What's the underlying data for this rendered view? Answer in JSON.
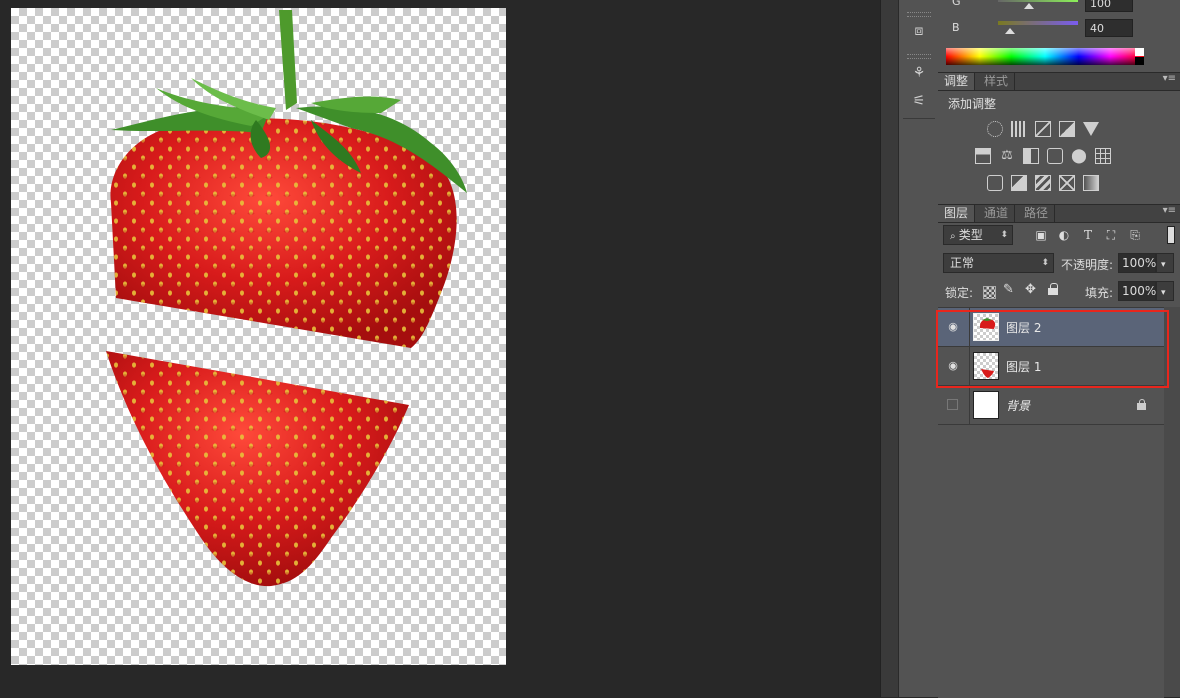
{
  "color_panel": {
    "g_label": "G",
    "g_value": "100",
    "g_ratio": 0.39,
    "b_label": "B",
    "b_value": "40",
    "b_ratio": 0.16
  },
  "adjust_panel": {
    "tabs": [
      {
        "label": "调整"
      },
      {
        "label": "样式"
      }
    ],
    "heading": "添加调整",
    "icons": [
      "brightness-contrast-icon",
      "levels-icon",
      "curves-icon",
      "exposure-icon",
      "vibrance-icon",
      "hue-saturation-icon",
      "color-balance-icon",
      "black-white-icon",
      "photo-filter-icon",
      "channel-mixer-icon",
      "color-lookup-icon",
      "invert-icon",
      "posterize-icon",
      "threshold-icon",
      "selective-color-icon",
      "gradient-map-icon"
    ]
  },
  "layers_panel": {
    "tabs": [
      {
        "label": "图层"
      },
      {
        "label": "通道"
      },
      {
        "label": "路径"
      }
    ],
    "filter_kind": "类型",
    "blend_mode": "正常",
    "opacity_label": "不透明度:",
    "opacity_value": "100%",
    "lock_label": "锁定:",
    "fill_label": "填充:",
    "fill_value": "100%",
    "layers": [
      {
        "name": "图层 2",
        "visible": true,
        "selected": true
      },
      {
        "name": "图层 1",
        "visible": true,
        "selected": false
      },
      {
        "name": "背景",
        "visible": false,
        "selected": false,
        "locked": true
      }
    ]
  },
  "colors": {
    "highlight": "#e8261d",
    "selected_row": "#5a6478",
    "strawberry": "#d81b1b",
    "leaf": "#3f8f2a"
  }
}
